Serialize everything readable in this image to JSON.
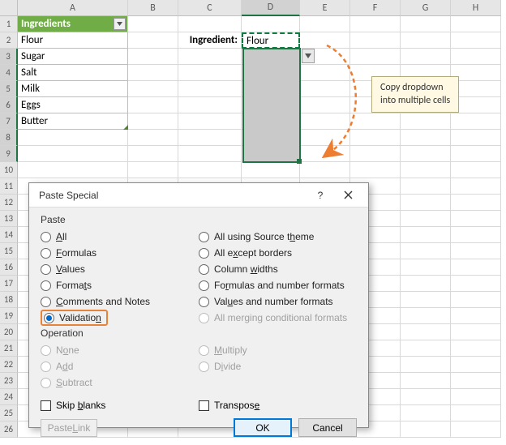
{
  "columns": [
    "A",
    "B",
    "C",
    "D",
    "E",
    "F",
    "G",
    "H"
  ],
  "rowCount": 26,
  "table": {
    "header": "Ingredients",
    "items": [
      "Flour",
      "Sugar",
      "Salt",
      "Milk",
      "Eggs",
      "Butter"
    ]
  },
  "label_c2": "Ingredient:",
  "d2_value": "Flour",
  "callout": {
    "line1": "Copy dropdown",
    "line2": "into multiple cells"
  },
  "dialog": {
    "title": "Paste Special",
    "group_paste": "Paste",
    "group_operation": "Operation",
    "left": {
      "all": "All",
      "formulas": "Formulas",
      "values": "Values",
      "formats": "Formats",
      "comments": "Comments and Notes",
      "validation": "Validation"
    },
    "right": {
      "theme": "All using Source theme",
      "except_borders": "All except borders",
      "col_widths": "Column widths",
      "form_num": "Formulas and number formats",
      "val_num": "Values and number formats",
      "merge_cf": "All merging conditional formats"
    },
    "op": {
      "none": "None",
      "add": "Add",
      "subtract": "Subtract",
      "multiply": "Multiply",
      "divide": "Divide"
    },
    "skip_blanks": "Skip blanks",
    "transpose": "Transpose",
    "paste_link": "Paste Link",
    "ok": "OK",
    "cancel": "Cancel"
  }
}
